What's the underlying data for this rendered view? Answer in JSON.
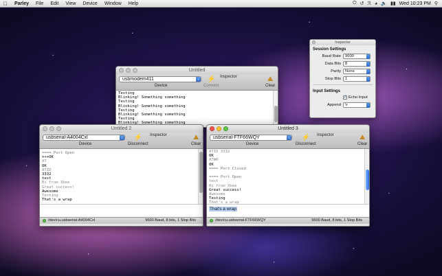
{
  "menubar": {
    "app": "Parley",
    "items": [
      "File",
      "Edit",
      "View",
      "Device",
      "Window",
      "Help"
    ],
    "clock": "Wed 10:23 PM"
  },
  "window1": {
    "title": "Untitled",
    "device": "usbmodem411",
    "device_label": "Device",
    "connect": "Connect",
    "inspector": "Inspector",
    "clear": "Clear",
    "lines": [
      {
        "t": "Testing",
        "k": "recv"
      },
      {
        "t": "Blinking! Something something",
        "k": "recv"
      },
      {
        "t": "Testing",
        "k": "recv"
      },
      {
        "t": "Blinking! Something something",
        "k": "recv"
      },
      {
        "t": "Testing",
        "k": "recv"
      },
      {
        "t": "Blinking! Something something",
        "k": "recv"
      },
      {
        "t": "Testing",
        "k": "recv"
      },
      {
        "t": "Blinking! Something something",
        "k": "recv"
      },
      {
        "t": "Testing",
        "k": "recv"
      }
    ]
  },
  "window2": {
    "title": "Untitled 2",
    "device": "usbserial-A4004Cxl",
    "device_label": "Device",
    "disconnect": "Disconnect",
    "inspector": "Inspector",
    "clear": "Clear",
    "lines": [
      {
        "t": "==== Port Open",
        "k": "info"
      },
      {
        "t": "+++OK",
        "k": "recv"
      },
      {
        "t": "AT",
        "k": "sent"
      },
      {
        "t": "OK",
        "k": "recv"
      },
      {
        "t": "ATID",
        "k": "sent"
      },
      {
        "t": "3332",
        "k": "recv"
      },
      {
        "t": "test",
        "k": "recv"
      },
      {
        "t": "Hi from Xbee",
        "k": "sent"
      },
      {
        "t": "Great success!",
        "k": "sent"
      },
      {
        "t": "Awesome",
        "k": "recv"
      },
      {
        "t": "Testing",
        "k": "sent"
      },
      {
        "t": "That's a wrap",
        "k": "recv"
      }
    ],
    "status_port": "/dev/cu.usbserial-A4004Cxl",
    "status_settings": "9600 Baud, 8 bits, 1 Stop Bits"
  },
  "window3": {
    "title": "Untitled 3",
    "device": "usbserial-FTF66WQY",
    "device_label": "Device",
    "disconnect": "Disconnect",
    "inspector": "Inspector",
    "clear": "Clear",
    "lines": [
      {
        "t": "ATID 3332",
        "k": "sent"
      },
      {
        "t": "OK",
        "k": "recv"
      },
      {
        "t": "ATWR",
        "k": "sent"
      },
      {
        "t": "OK",
        "k": "recv"
      },
      {
        "t": "==== Port Closed",
        "k": "info"
      },
      {
        "t": "",
        "k": "recv"
      },
      {
        "t": "==== Port Open",
        "k": "info"
      },
      {
        "t": "test",
        "k": "sent"
      },
      {
        "t": "Hi from Xbee",
        "k": "sent"
      },
      {
        "t": "Great success!",
        "k": "recv"
      },
      {
        "t": "Awesome",
        "k": "sent"
      },
      {
        "t": "Testing",
        "k": "recv"
      },
      {
        "t": "That's a wrap",
        "k": "sent"
      }
    ],
    "input_text": "That's a wrap",
    "status_port": "/dev/cu.usbserial-FTF66WQY",
    "status_settings": "9600 Baud, 8 bits, 1 Stop Bits"
  },
  "inspector": {
    "title": "Inspector",
    "session_header": "Session Settings",
    "baud_label": "Baud Rate",
    "baud_value": "9600",
    "data_bits_label": "Data Bits",
    "data_bits_value": "8",
    "parity_label": "Parity",
    "parity_value": "None",
    "stop_bits_label": "Stop Bits",
    "stop_bits_value": "1",
    "input_header": "Input Settings",
    "echo_label": "Echo Input",
    "append_label": "Append",
    "append_value": "\\r"
  }
}
